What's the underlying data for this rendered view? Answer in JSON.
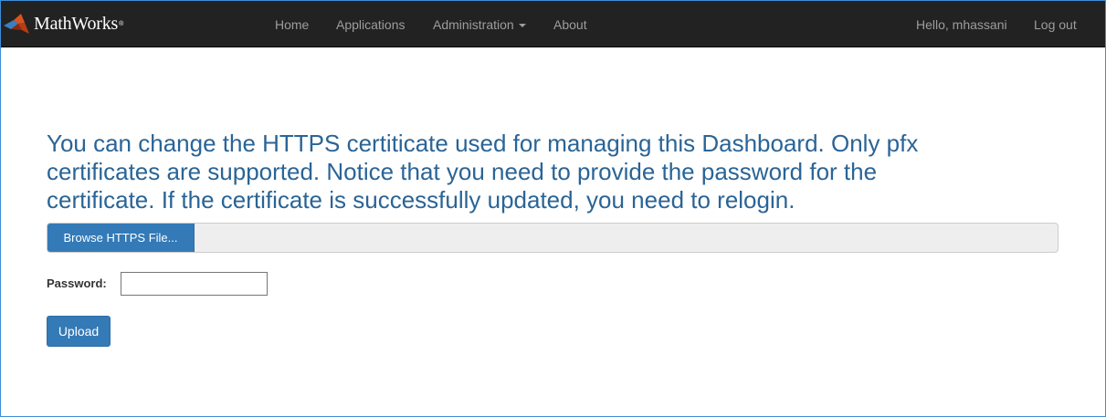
{
  "navbar": {
    "brand": "MathWorks",
    "brand_mark": "®",
    "links": {
      "home": "Home",
      "applications": "Applications",
      "administration": "Administration",
      "about": "About"
    },
    "greeting": "Hello, mhassani",
    "logout": "Log out",
    "background_color": "#222222"
  },
  "main": {
    "intro_line1": "You can change the HTTPS certiticate used for managing this Dashboard. Only pfx",
    "intro_line2": "certificates are supported. Notice that you need to provide the password for the",
    "intro_line3": "certificate. If the certificate is successfully updated, you need to relogin.",
    "browse_label": "Browse HTTPS File...",
    "selected_file": "",
    "password_label": "Password:",
    "password_value": "",
    "upload_label": "Upload",
    "accent_color": "#337ab7",
    "heading_color": "#2a6496"
  },
  "icons": {
    "brand_logo": "matlab-membrane-logo-icon",
    "dropdown": "caret-down-icon"
  }
}
